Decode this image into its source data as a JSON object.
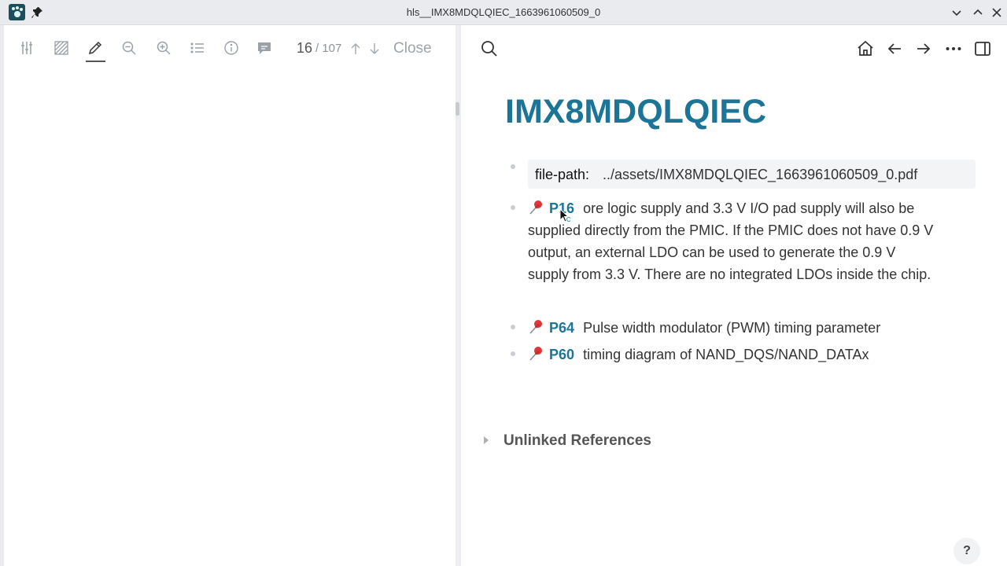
{
  "window": {
    "title": "hls__IMX8MDQLQIEC_1663961060509_0"
  },
  "pdf_toolbar": {
    "icons": [
      "sliders-icon",
      "hatch-icon",
      "pencil-icon",
      "zoom-out-icon",
      "zoom-in-icon",
      "outline-list-icon",
      "info-icon",
      "comment-icon"
    ],
    "current_page": "16",
    "total_pages": "/ 107",
    "close_label": "Close"
  },
  "right_toolbar": {
    "icons": [
      "search-icon",
      "home-icon",
      "back-arrow-icon",
      "forward-arrow-icon",
      "more-icon",
      "sidebar-toggle-icon"
    ]
  },
  "page": {
    "title": "IMX8MDQLQIEC",
    "property": {
      "key": "file-path:",
      "value": "../assets/IMX8MDQLQIEC_1663961060509_0.pdf"
    },
    "blocks": [
      {
        "ref": "P16",
        "text_lines": [
          "ore logic supply and 3.3 V I/O pad supply will also be",
          "supplied directly from the PMIC. If the PMIC does not have 0.9 V",
          "output, an external LDO can be used to generate the 0.9 V",
          "supply from 3.3 V. There are no integrated LDOs inside the chip."
        ]
      },
      {
        "ref": "P64",
        "text": "Pulse width modulator (PWM) timing parameter"
      },
      {
        "ref": "P60",
        "text": "timing diagram of NAND_DQS/NAND_DATAx"
      }
    ],
    "unlinked_references_label": "Unlinked References"
  },
  "help_label": "?",
  "colors": {
    "accent": "#1c7596",
    "titlebar": "#e9ebee"
  }
}
